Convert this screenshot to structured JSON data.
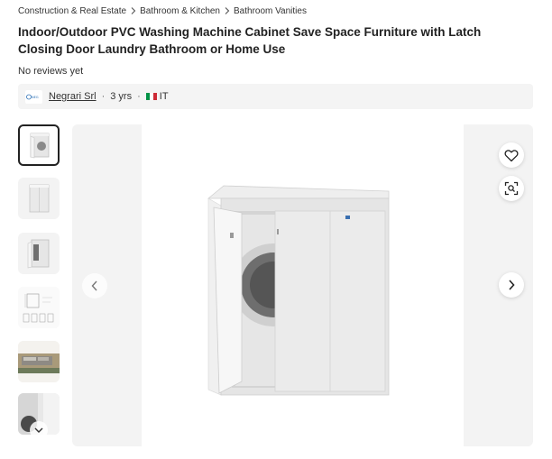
{
  "breadcrumb": {
    "items": [
      "Construction & Real Estate",
      "Bathroom & Kitchen",
      "Bathroom Vanities"
    ]
  },
  "product": {
    "title": "Indoor/Outdoor PVC Washing Machine Cabinet Save Space Furniture with Latch Closing Door Laundry Bathroom or Home Use",
    "reviews": "No reviews yet"
  },
  "supplier": {
    "logo_text": "NEGRARI",
    "name": "Negrari Srl",
    "years": "3 yrs",
    "country": "IT"
  },
  "gallery": {
    "thumbnails": [
      "cabinet-open-door-thumb",
      "cabinet-closed-thumb",
      "cabinet-side-open-thumb",
      "dimension-drawing-thumb",
      "factory-aerial-thumb",
      "cabinet-detail-thumb"
    ],
    "active_thumbnail": 1,
    "icons": {
      "previous": "chevron-left-icon",
      "next": "chevron-right-icon",
      "favorite": "heart-icon",
      "image_search": "image-search-icon",
      "thumbnail_scroll": "chevron-down-icon"
    }
  },
  "colors": {
    "flag_green": "#009246",
    "flag_white": "#ffffff",
    "flag_red": "#ce2b37",
    "accent_dark": "#222222",
    "panel_gray": "#f3f3f3"
  }
}
